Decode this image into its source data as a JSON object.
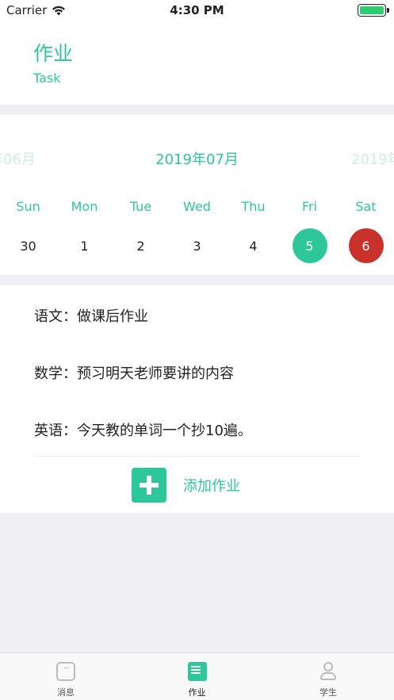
{
  "status": {
    "carrier": "Carrier",
    "time": "4:30 PM",
    "battery_level": 1.0
  },
  "header": {
    "title": "作业",
    "subtitle": "Task"
  },
  "calendar": {
    "prev_month": "年06月",
    "current_month": "2019年07月",
    "next_month": "2019年",
    "weekdays": [
      "Sun",
      "Mon",
      "Tue",
      "Wed",
      "Thu",
      "Fri",
      "Sat"
    ],
    "days": [
      "30",
      "1",
      "2",
      "3",
      "4",
      "5",
      "6"
    ],
    "today_color": "#2dc79a",
    "selected_color": "#c8322b"
  },
  "tasks": [
    "语文：做课后作业",
    "数学：预习明天老师要讲的内容",
    "英语：今天教的单词一个抄10遍。"
  ],
  "add_button": {
    "label": "添加作业",
    "icon": "plus-icon"
  },
  "tabbar": {
    "tabs": [
      {
        "label": "消息",
        "icon": "message-icon"
      },
      {
        "label": "作业",
        "icon": "homework-icon"
      },
      {
        "label": "学生",
        "icon": "student-icon"
      }
    ]
  },
  "colors": {
    "accent": "#2dc79a",
    "danger": "#c8322b",
    "background": "#efeff4"
  }
}
